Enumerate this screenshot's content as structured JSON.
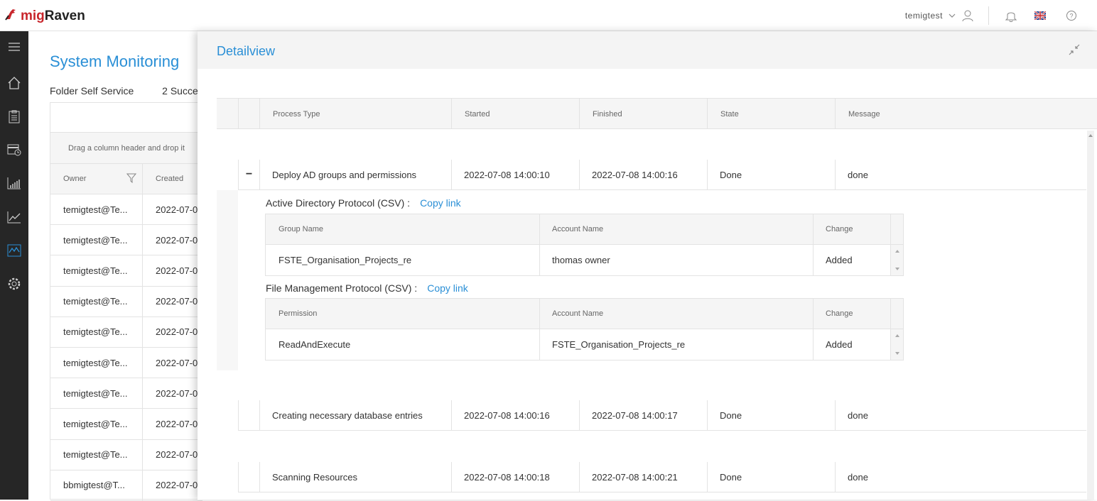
{
  "app": {
    "logo_prefix": "mig",
    "logo_name": "Raven"
  },
  "topbar": {
    "username": "temigtest"
  },
  "sidebar": {
    "items": [
      "menu-icon",
      "home-icon",
      "clipboard-icon",
      "calendar-clock-icon",
      "bar-chart-icon",
      "line-chart-icon",
      "monitoring-icon",
      "gear-icon"
    ],
    "active_index": 6,
    "active_color": "#2a8fd6"
  },
  "page": {
    "title": "System Monitoring",
    "service": "Folder Self Service",
    "status": "2 Succe"
  },
  "bg_grid": {
    "group_hint": "Drag a column header and drop it",
    "columns": [
      "Owner",
      "Created"
    ],
    "rows": [
      [
        "temigtest@Te...",
        "2022-07-0"
      ],
      [
        "temigtest@Te...",
        "2022-07-0"
      ],
      [
        "temigtest@Te...",
        "2022-07-0"
      ],
      [
        "temigtest@Te...",
        "2022-07-0"
      ],
      [
        "temigtest@Te...",
        "2022-07-0"
      ],
      [
        "temigtest@Te...",
        "2022-07-0"
      ],
      [
        "temigtest@Te...",
        "2022-07-0"
      ],
      [
        "temigtest@Te...",
        "2022-07-0"
      ],
      [
        "temigtest@Te...",
        "2022-07-0"
      ],
      [
        "bbmigtest@T...",
        "2022-07-0"
      ]
    ]
  },
  "detail": {
    "title": "Detailview",
    "columns": [
      "Process Type",
      "Started",
      "Finished",
      "State",
      "Message"
    ],
    "rows": [
      {
        "type": "Deploy AD groups and permissions",
        "started": "2022-07-08 14:00:10",
        "finished": "2022-07-08 14:00:16",
        "state": "Done",
        "message": "done",
        "expand": "−"
      },
      {
        "type": "Creating necessary database entries",
        "started": "2022-07-08 14:00:16",
        "finished": "2022-07-08 14:00:17",
        "state": "Done",
        "message": "done"
      },
      {
        "type": "Scanning Resources",
        "started": "2022-07-08 14:00:18",
        "finished": "2022-07-08 14:00:21",
        "state": "Done",
        "message": "done"
      }
    ],
    "ad_protocol": {
      "label": "Active Directory Protocol (CSV) :",
      "link": "Copy link",
      "columns": [
        "Group Name",
        "Account Name",
        "Change"
      ],
      "row": [
        "FSTE_Organisation_Projects_re",
        "thomas owner",
        "Added"
      ]
    },
    "fm_protocol": {
      "label": "File Management Protocol (CSV) :",
      "link": "Copy link",
      "columns": [
        "Permission",
        "Account Name",
        "Change"
      ],
      "row": [
        "ReadAndExecute",
        "FSTE_Organisation_Projects_re",
        "Added"
      ]
    }
  }
}
